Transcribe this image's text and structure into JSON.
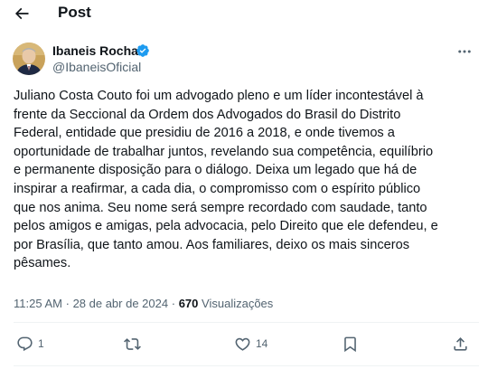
{
  "header": {
    "title": "Post",
    "back_icon": "arrow-left-icon"
  },
  "author": {
    "name": "Ibaneis Rocha",
    "handle": "@IbaneisOficial",
    "verified_icon": "verified-badge-icon",
    "verified_color": "#1d9bf0"
  },
  "tweet": {
    "text": "Juliano Costa Couto foi um advogado pleno e um líder incontestável à\nfrente da Seccional da Ordem dos Advogados do Brasil do Distrito\nFederal, entidade que presidiu de 2016 a 2018, e onde tivemos a\noportunidade de trabalhar juntos, revelando sua competência, equilíbrio\ne permanente disposição para o diálogo. Deixa um legado que há de\ninspirar a reafirmar, a cada dia, o compromisso com o espírito público\nque nos anima. Seu nome será sempre recordado com saudade, tanto\npelos amigos e amigas, pela advocacia, pelo Direito que ele defendeu, e\npor Brasília, que tanto amou. Aos familiares, deixo os mais sinceros\npêsames.",
    "time": "11:25 AM",
    "separator": "·",
    "date": "28 de abr de 2024",
    "views_count": "670",
    "views_label": "Visualizações"
  },
  "actions": {
    "reply_count": "1",
    "retweet_count": "",
    "like_count": "14",
    "bookmark_count": "",
    "share_count": ""
  },
  "colors": {
    "text": "#0f1419",
    "secondary": "#536471",
    "divider": "#eff3f4"
  }
}
